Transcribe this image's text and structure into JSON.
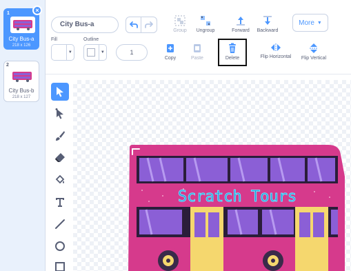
{
  "costumes": [
    {
      "num": "1",
      "name": "City Bus-a",
      "dims": "218 x 126",
      "selected": true
    },
    {
      "num": "2",
      "name": "City Bus-b",
      "dims": "218 x 127",
      "selected": false
    }
  ],
  "costume_delete_glyph": "×",
  "toolbar": {
    "costume_name": "City Bus-a",
    "group_label": "Group",
    "ungroup_label": "Ungroup",
    "forward_label": "Forward",
    "backward_label": "Backward",
    "more_label": "More",
    "fill_label": "Fill",
    "outline_label": "Outline",
    "outline_width": "1",
    "copy_label": "Copy",
    "paste_label": "Paste",
    "delete_label": "Delete",
    "flip_h_label": "Flip Horizontal",
    "flip_v_label": "Flip Vertical"
  },
  "canvas": {
    "banner_text": "Scratch Tours"
  },
  "colors": {
    "accent": "#4c97ff",
    "bus_body": "#d63a8c",
    "bus_window": "#8b5fd6",
    "door": "#f5d76e"
  },
  "icons": [
    "select-icon",
    "reshape-icon",
    "brush-icon",
    "eraser-icon",
    "fill-icon",
    "text-icon",
    "line-icon",
    "circle-icon",
    "rectangle-icon"
  ]
}
